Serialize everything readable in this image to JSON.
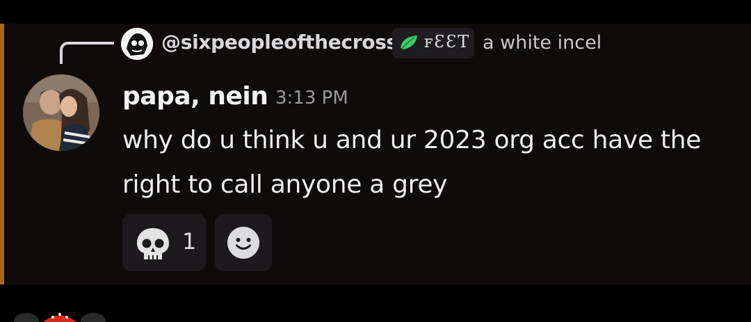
{
  "reply": {
    "username": "@sixpeopleofthecross",
    "tag_text": "ꜰƐƐT",
    "content": "a white incel"
  },
  "message": {
    "author": "papa, nein",
    "timestamp": "3:13 PM",
    "text": "why do u think u and ur 2023 org acc have the right to call anyone a grey"
  },
  "reactions": [
    {
      "emoji": "skull-icon",
      "count": "1"
    },
    {
      "emoji": "add-reaction-icon"
    }
  ],
  "colors": {
    "background": "#000000",
    "message_bg": "#0f0b0a",
    "mention_bar": "#a8651c",
    "reaction_bg": "#1c1a1c"
  }
}
